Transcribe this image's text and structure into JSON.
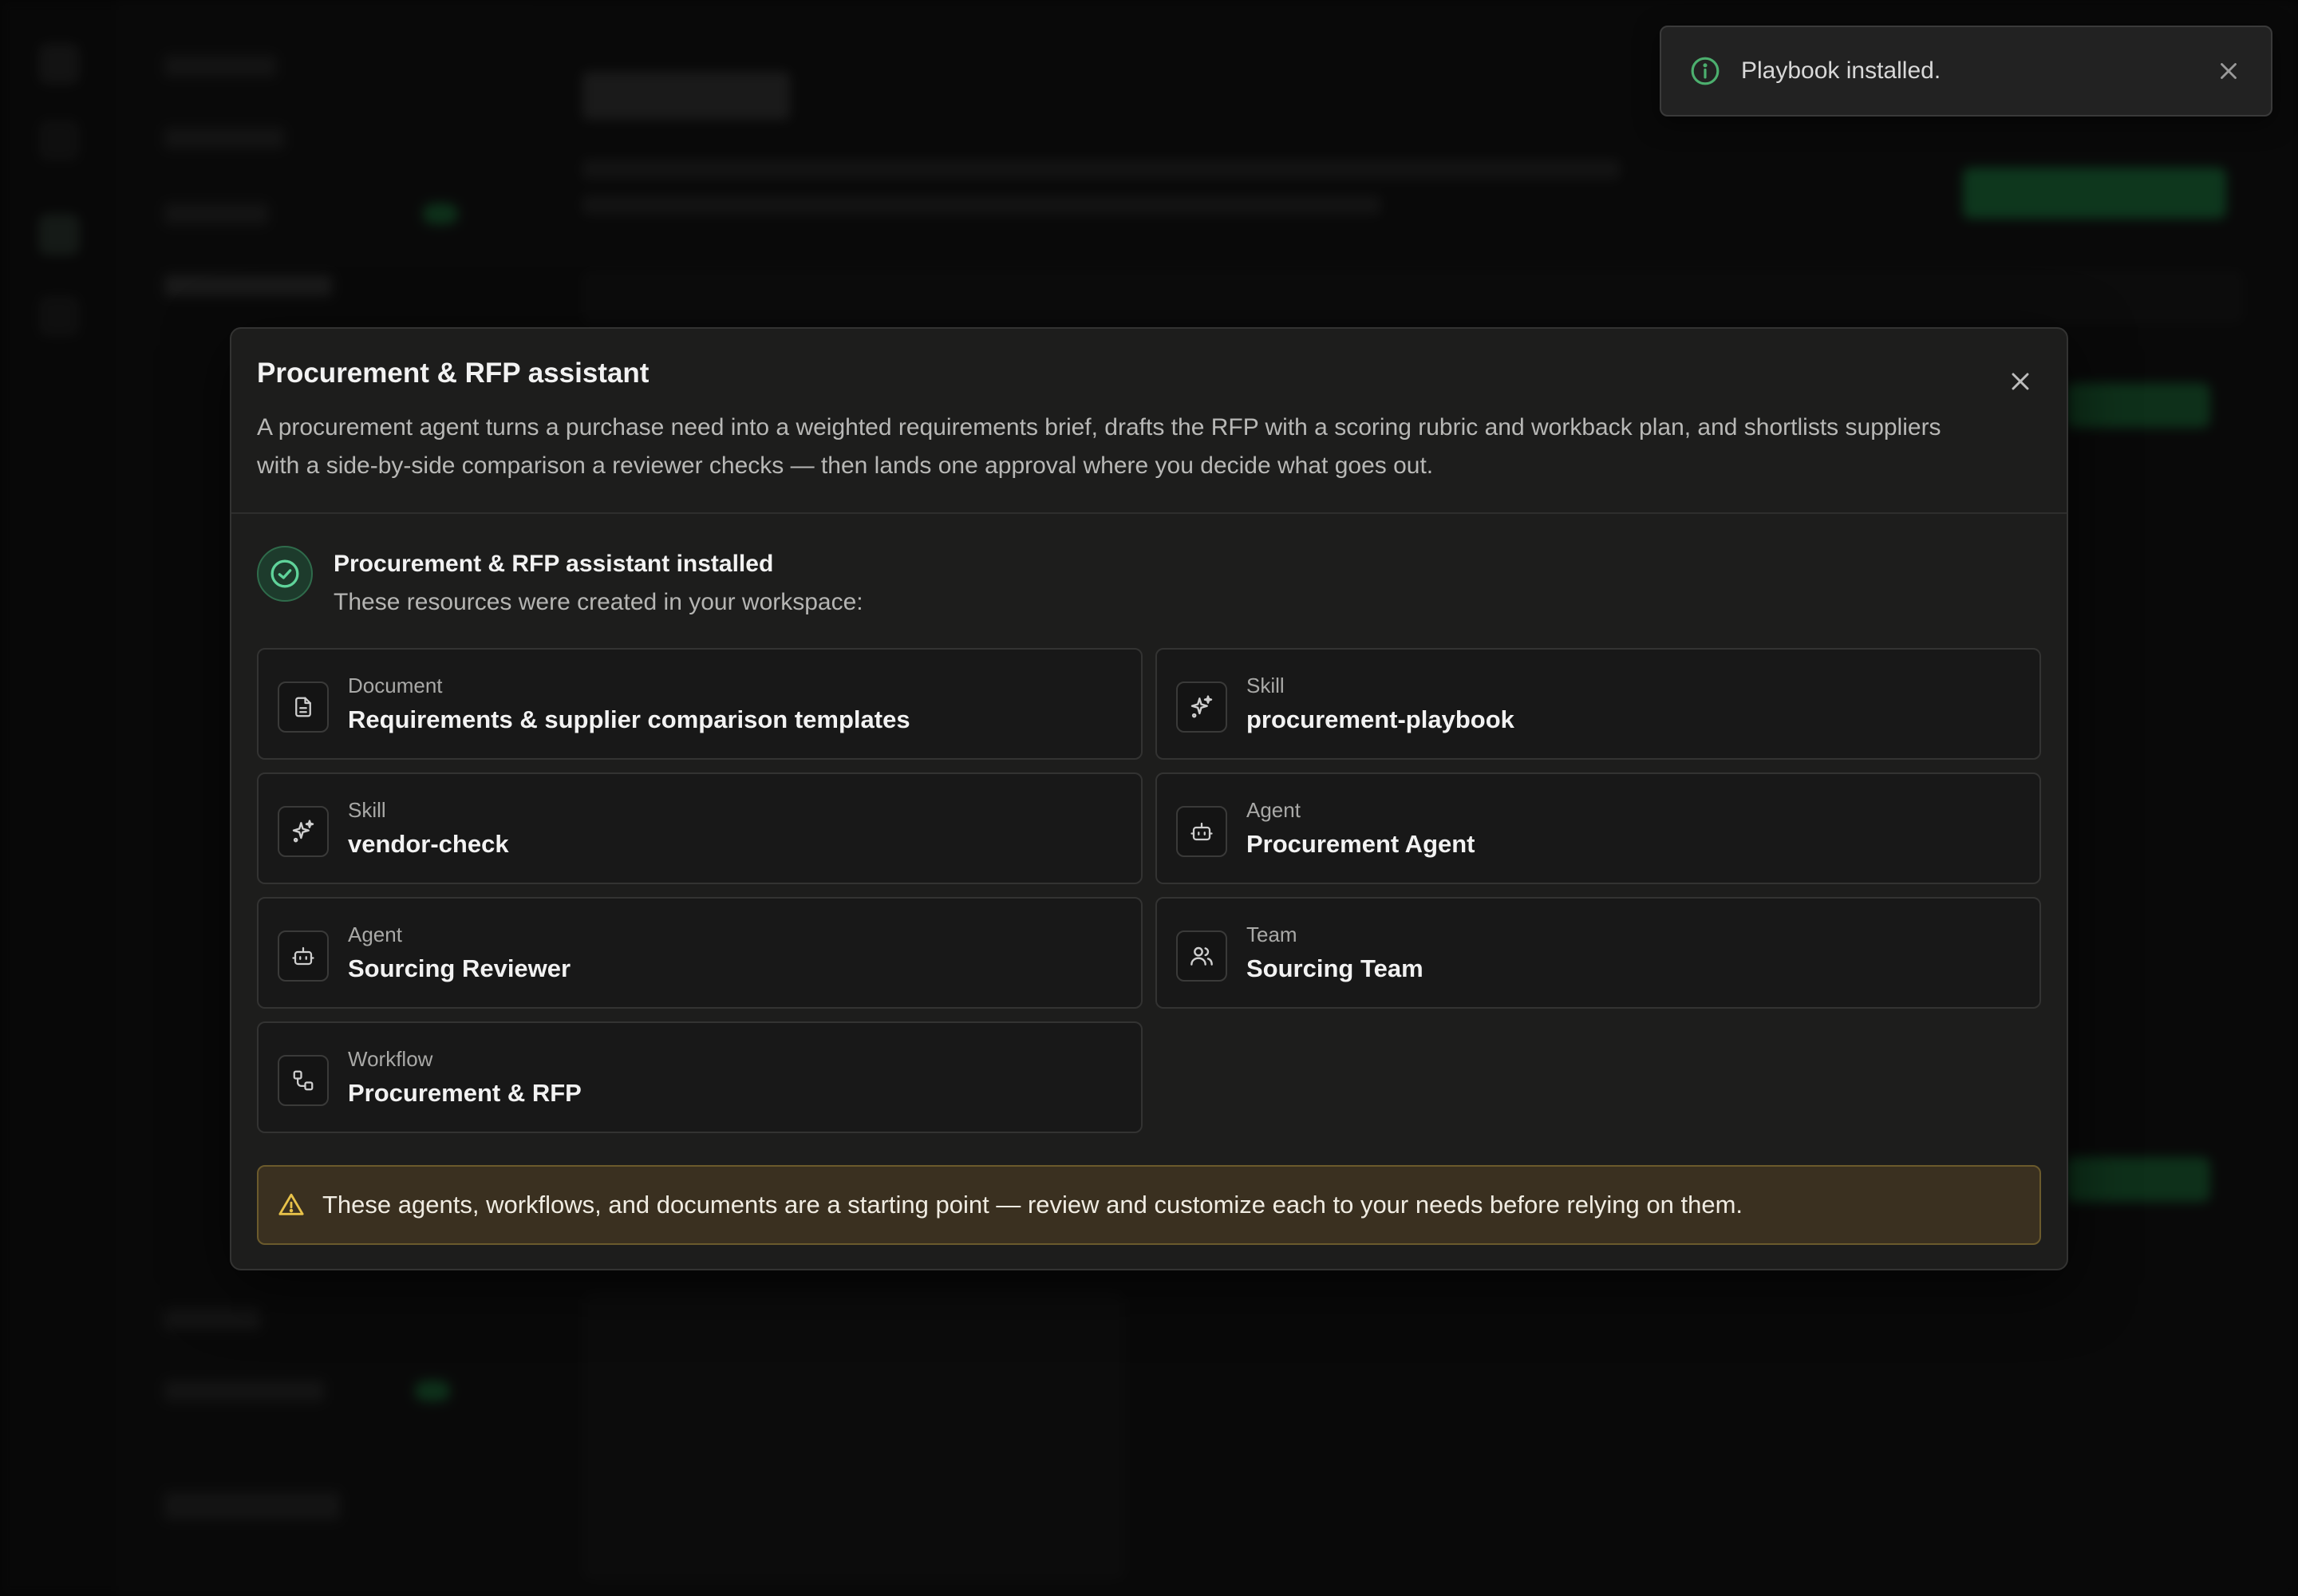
{
  "toast": {
    "message": "Playbook installed.",
    "icon": "info-icon",
    "accent": "#4caf6e"
  },
  "modal": {
    "title": "Procurement & RFP assistant",
    "description": "A procurement agent turns a purchase need into a weighted requirements brief, drafts the RFP with a scoring rubric and workback plan, and shortlists suppliers with a side-by-side comparison a reviewer checks — then lands one approval where you decide what goes out.",
    "installed": {
      "title": "Procurement & RFP assistant installed",
      "subtitle": "These resources were created in your workspace:",
      "icon": "check-circle-icon"
    },
    "resources": [
      {
        "type": "Document",
        "name": "Requirements & supplier comparison templates",
        "icon": "document-icon"
      },
      {
        "type": "Skill",
        "name": "procurement-playbook",
        "icon": "sparkles-icon"
      },
      {
        "type": "Skill",
        "name": "vendor-check",
        "icon": "sparkles-icon"
      },
      {
        "type": "Agent",
        "name": "Procurement Agent",
        "icon": "bot-icon"
      },
      {
        "type": "Agent",
        "name": "Sourcing Reviewer",
        "icon": "bot-icon"
      },
      {
        "type": "Team",
        "name": "Sourcing Team",
        "icon": "users-icon"
      },
      {
        "type": "Workflow",
        "name": "Procurement & RFP",
        "icon": "workflow-icon"
      }
    ],
    "warning": {
      "text": "These agents, workflows, and documents are a starting point — review and customize each to your needs before relying on them.",
      "icon": "warning-triangle-icon",
      "color": "#e8c24a"
    }
  },
  "colors": {
    "modal_bg": "#1d1d1c",
    "card_bg": "#181818",
    "success": "#5fd39a",
    "warning_bg": "#3a3020"
  }
}
